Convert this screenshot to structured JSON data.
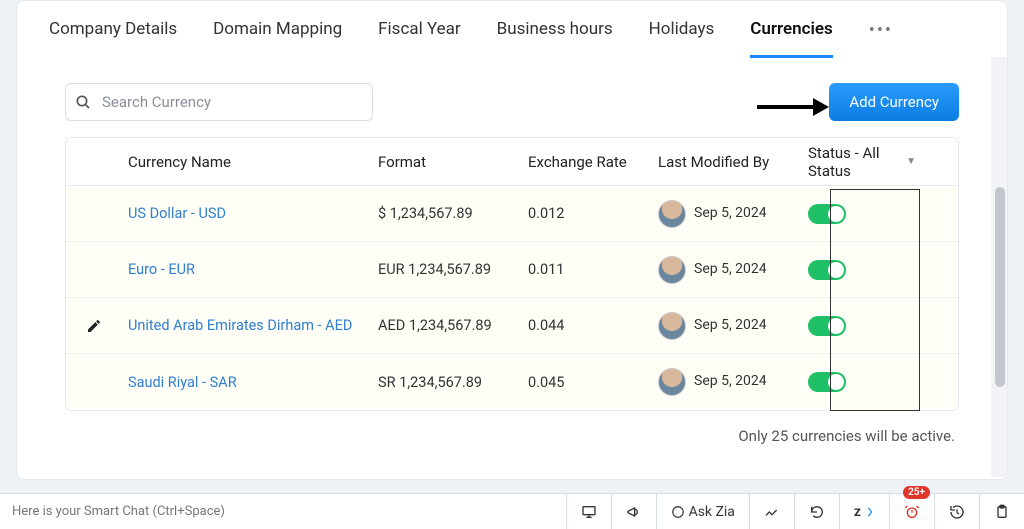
{
  "tabs": {
    "items": [
      {
        "label": "Company Details"
      },
      {
        "label": "Domain Mapping"
      },
      {
        "label": "Fiscal Year"
      },
      {
        "label": "Business hours"
      },
      {
        "label": "Holidays"
      },
      {
        "label": "Currencies"
      }
    ],
    "activeIndex": 5
  },
  "search": {
    "placeholder": "Search Currency"
  },
  "addButton": {
    "label": "Add Currency"
  },
  "table": {
    "columns": {
      "name": "Currency Name",
      "format": "Format",
      "rate": "Exchange Rate",
      "modified": "Last Modified By",
      "status": "Status - All Status"
    },
    "rows": [
      {
        "name": "US Dollar - USD",
        "format": "$ 1,234,567.89",
        "rate": "0.012",
        "modified": "Sep 5, 2024",
        "active": true,
        "editing": false
      },
      {
        "name": "Euro - EUR",
        "format": "EUR 1,234,567.89",
        "rate": "0.011",
        "modified": "Sep 5, 2024",
        "active": true,
        "editing": false
      },
      {
        "name": "United Arab Emirates Dirham - AED",
        "format": "AED 1,234,567.89",
        "rate": "0.044",
        "modified": "Sep 5, 2024",
        "active": true,
        "editing": true
      },
      {
        "name": "Saudi Riyal - SAR",
        "format": "SR 1,234,567.89",
        "rate": "0.045",
        "modified": "Sep 5, 2024",
        "active": true,
        "editing": false
      }
    ]
  },
  "footerNote": "Only 25 currencies will be active.",
  "bottomBar": {
    "smartChat": "Here is your Smart Chat (Ctrl+Space)",
    "askZia": "Ask Zia",
    "badge": "25+"
  }
}
